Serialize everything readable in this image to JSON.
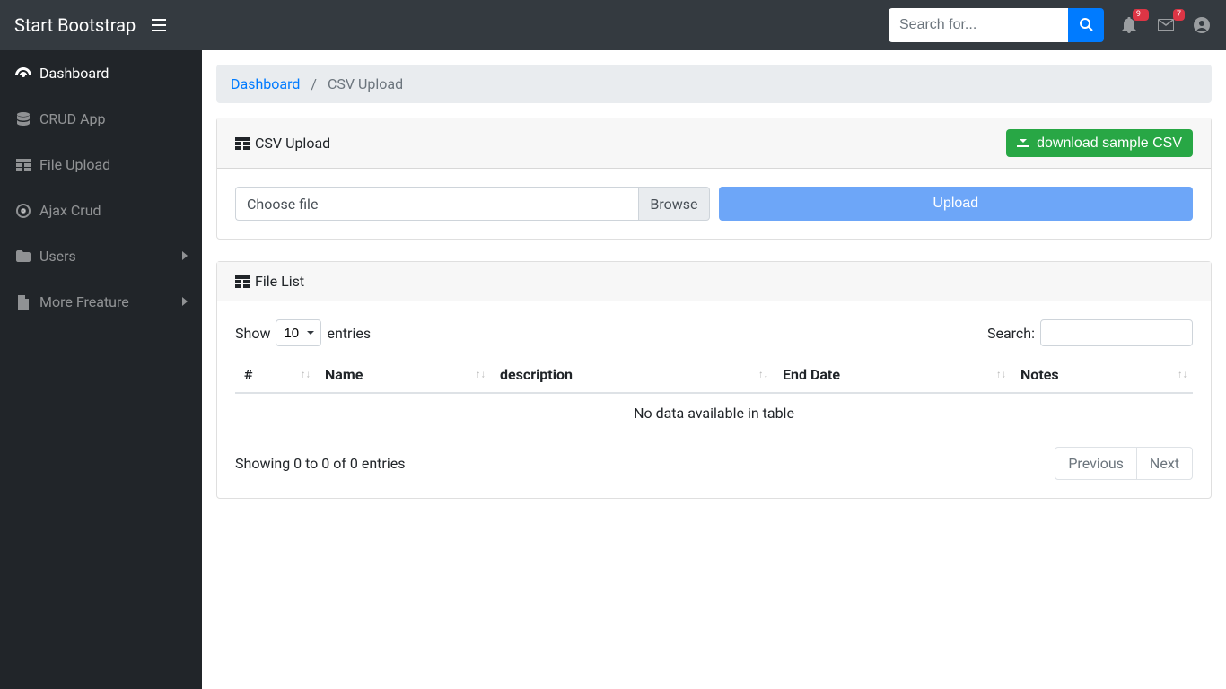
{
  "navbar": {
    "brand": "Start Bootstrap",
    "search_placeholder": "Search for...",
    "notifications_badge": "9+",
    "messages_badge": "7"
  },
  "sidebar": {
    "items": [
      {
        "label": "Dashboard",
        "icon": "dashboard-icon",
        "active": true
      },
      {
        "label": "CRUD App",
        "icon": "database-icon"
      },
      {
        "label": "File Upload",
        "icon": "table-icon"
      },
      {
        "label": "Ajax Crud",
        "icon": "target-icon"
      },
      {
        "label": "Users",
        "icon": "folder-icon",
        "expandable": true
      },
      {
        "label": "More Freature",
        "icon": "file-icon",
        "expandable": true
      }
    ]
  },
  "breadcrumb": {
    "items": [
      {
        "label": "Dashboard",
        "link": true
      },
      {
        "label": "CSV Upload",
        "link": false
      }
    ],
    "separator": "/"
  },
  "upload_card": {
    "title": "CSV Upload",
    "download_button": "download sample CSV",
    "choose_file_placeholder": "Choose file",
    "browse_label": "Browse",
    "upload_button": "Upload"
  },
  "file_list_card": {
    "title": "File List",
    "show_label": "Show",
    "entries_label": "entries",
    "page_size": "10",
    "search_label": "Search:",
    "columns": [
      "#",
      "Name",
      "description",
      "End Date",
      "Notes"
    ],
    "empty_message": "No data available in table",
    "info_text": "Showing 0 to 0 of 0 entries",
    "prev_label": "Previous",
    "next_label": "Next"
  }
}
